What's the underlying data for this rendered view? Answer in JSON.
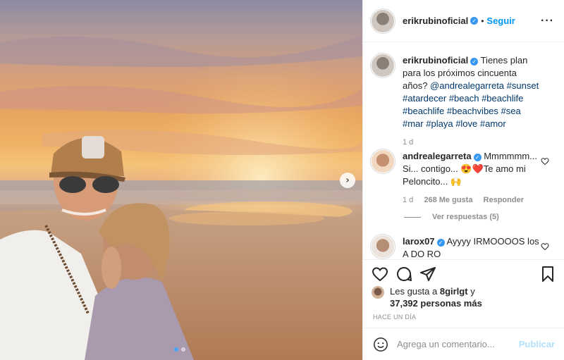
{
  "post": {
    "slide_dots": 2,
    "active_dot": 0
  },
  "header": {
    "username": "erikrubinoficial",
    "separator": "•",
    "follow_label": "Seguir",
    "more_label": "···"
  },
  "caption": {
    "username": "erikrubinoficial",
    "text": "Tienes plan para los próximos cincuenta años?",
    "tags": [
      "@andrealegarreta",
      "#sunset",
      "#atardecer",
      "#beach",
      "#beachlife",
      "#beachlife",
      "#beachvibes",
      "#sea",
      "#mar",
      "#playa",
      "#love",
      "#amor"
    ],
    "time": "1 d"
  },
  "comments": [
    {
      "username": "andrealegarreta",
      "text": "Mmmmmm... Si... contigo... 😍❤️Te amo mi Peloncito... 🙌",
      "time": "1 d",
      "likes": "268 Me gusta",
      "reply_label": "Responder",
      "view_replies": "Ver respuestas (5)"
    },
    {
      "username": "larox07",
      "text": "Ayyyy IRMOOOOS los A DO RO"
    }
  ],
  "likes": {
    "prefix": "Les gusta a",
    "first_user": "8girlgt",
    "conjunction": "y",
    "others": "37,392 personas más"
  },
  "date_label": "HACE UN DÍA",
  "add_comment": {
    "placeholder": "Agrega un comentario...",
    "publish_label": "Publicar"
  },
  "colors": {
    "accent": "#0095f6",
    "verified": "#3897f0",
    "publish_disabled": "#b2dffc"
  }
}
